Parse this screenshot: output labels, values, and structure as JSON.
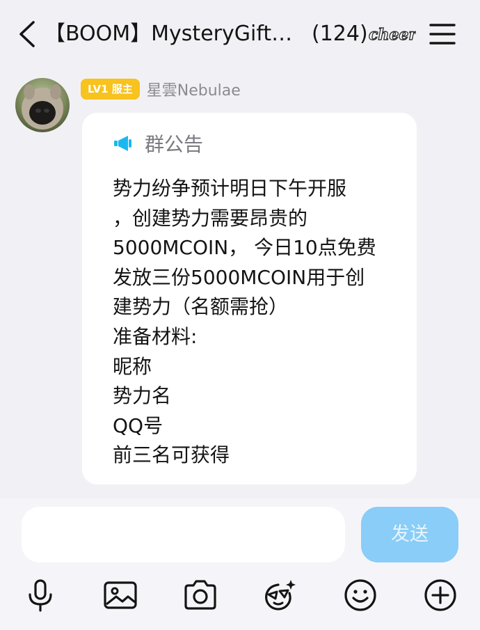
{
  "header": {
    "title": "【BOOM】MysteryGift…",
    "member_count": "(124)",
    "badge_text": "cheers"
  },
  "message": {
    "sender": {
      "level_badge": "LV1 服主",
      "name": "星雲Nebulae"
    },
    "notice": {
      "title": "群公告",
      "lines": [
        "势力纷争预计明日下午开服",
        "，创建势力需要昂贵的",
        "5000MCOIN， 今日10点免费",
        "发放三份5000MCOIN用于创",
        "建势力（名额需抢）",
        "准备材料:",
        "昵称",
        "势力名",
        "QQ号",
        "前三名可获得"
      ]
    }
  },
  "input": {
    "value": "",
    "send_label": "发送"
  },
  "toolbar": {
    "icons": [
      "microphone-icon",
      "image-icon",
      "camera-icon",
      "sticker-icon",
      "emoji-icon",
      "plus-icon"
    ]
  },
  "colors": {
    "background": "#f1f1f5",
    "bubble": "#ffffff",
    "level_badge": "#f8c21f",
    "send_button": "#89cdf8",
    "megaphone": "#1ab8f0"
  }
}
